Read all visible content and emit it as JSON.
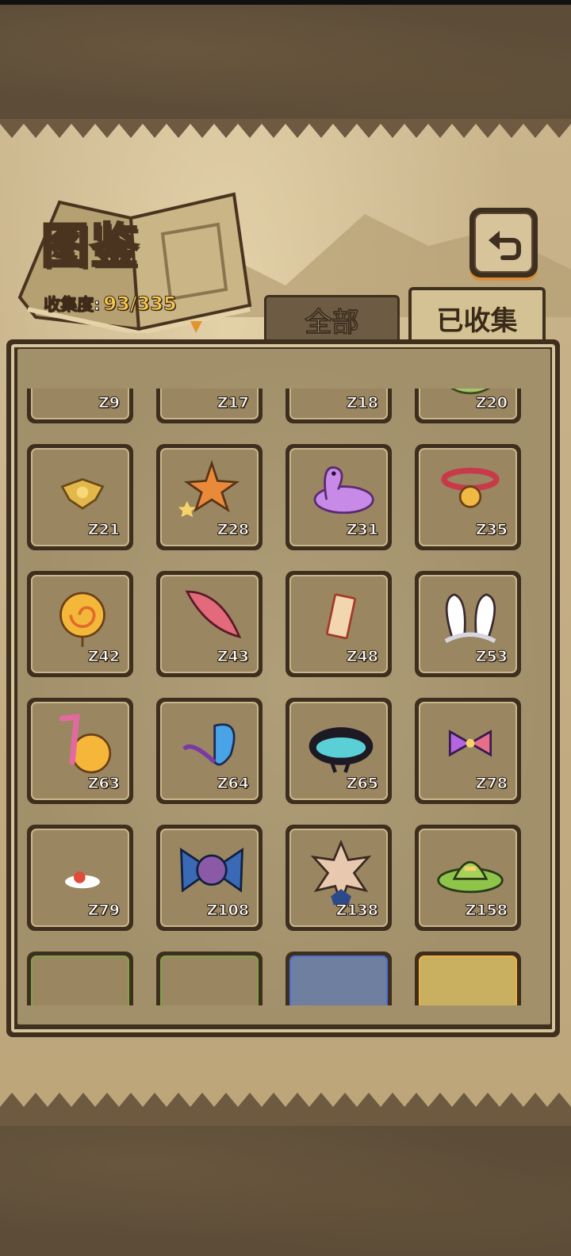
{
  "header": {
    "title": "图鉴",
    "progress_label": "收集度:",
    "progress_value": "93/335"
  },
  "tabs": {
    "all": "全部",
    "collected": "已收集"
  },
  "items": [
    {
      "id": "Z9",
      "icon": "egg-nest-icon"
    },
    {
      "id": "Z17",
      "icon": "silver-crown-icon"
    },
    {
      "id": "Z18",
      "icon": "silver-gem-icon"
    },
    {
      "id": "Z20",
      "icon": "green-sprout-hat-icon"
    },
    {
      "id": "Z21",
      "icon": "gold-badge-icon"
    },
    {
      "id": "Z28",
      "icon": "stars-icon"
    },
    {
      "id": "Z31",
      "icon": "purple-swim-ring-icon"
    },
    {
      "id": "Z35",
      "icon": "bell-collar-icon"
    },
    {
      "id": "Z42",
      "icon": "sun-lollipop-icon"
    },
    {
      "id": "Z43",
      "icon": "pink-feather-icon"
    },
    {
      "id": "Z48",
      "icon": "red-talisman-icon"
    },
    {
      "id": "Z53",
      "icon": "bunny-ears-icon"
    },
    {
      "id": "Z63",
      "icon": "orange-straw-icon"
    },
    {
      "id": "Z64",
      "icon": "butterfly-icon"
    },
    {
      "id": "Z65",
      "icon": "teal-mushroom-hat-icon"
    },
    {
      "id": "Z78",
      "icon": "rainbow-bow-icon"
    },
    {
      "id": "Z79",
      "icon": "fried-egg-icon"
    },
    {
      "id": "Z108",
      "icon": "blue-bow-icon"
    },
    {
      "id": "Z138",
      "icon": "flower-ribbon-icon"
    },
    {
      "id": "Z158",
      "icon": "straw-hat-icon"
    }
  ],
  "colors": {
    "progress": "#f6c94a",
    "frame": "#3f2f1f",
    "panel": "#a2906a"
  }
}
